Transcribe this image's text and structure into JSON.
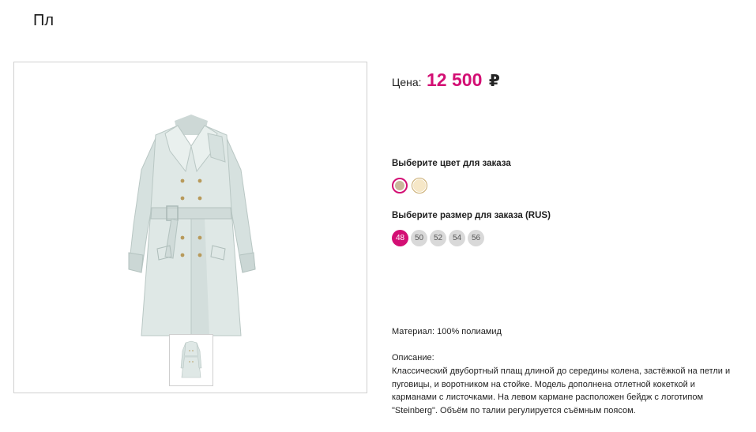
{
  "page": {
    "title": "Пл"
  },
  "product": {
    "price_label": "Цена:",
    "price_value": "12 500",
    "currency": "₽",
    "color_label": "Выберите цвет для заказа",
    "colors": [
      {
        "hex": "#c9b79b",
        "selected": true
      },
      {
        "hex": "#f6e7c7",
        "selected": false
      }
    ],
    "size_label": "Выберите размер для заказа (RUS)",
    "sizes": [
      "48",
      "50",
      "52",
      "54",
      "56"
    ],
    "selected_size": "48",
    "material": "Материал: 100% полиамид",
    "description_heading": "Описание:",
    "description": "Классический  двубортный плащ длиной до середины колена, застёжкой на петли и пуговицы, и воротником на стойке. Модель дополнена отлетной кокеткой и карманами с листочками. На левом кармане расположен бейдж с логотипом \"Steinberg\". Объём по талии регулируется съёмным поясом."
  },
  "colors": {
    "accent": "#d30f74",
    "coat": "#dfe8e6",
    "size_bubble": "#d9d9d9"
  },
  "icons": {
    "main_image": "trench-coat-image",
    "thumbnail": "trench-coat-thumbnail"
  }
}
